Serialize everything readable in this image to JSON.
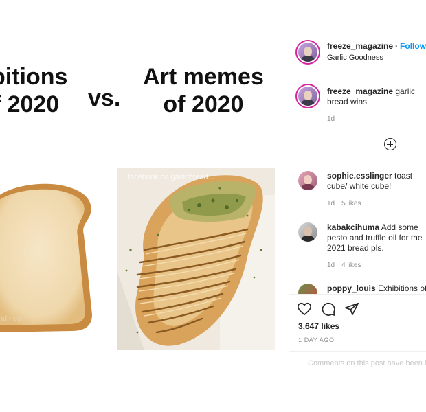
{
  "meme": {
    "title_left_line1": "ibitions",
    "title_left_line2": "f 2020",
    "vs": "vs.",
    "title_right_line1": "Art memes",
    "title_right_line2": "of 2020",
    "watermark_right": "facebook.co   garlicbread...",
    "watermark_left": "ndines"
  },
  "post": {
    "header": {
      "username": "freeze_magazine",
      "dot": "·",
      "follow": "Follow",
      "subtitle": "Garlic Goodness"
    },
    "caption": {
      "username": "freeze_magazine",
      "text": " garlic bread wins",
      "time": "1d"
    },
    "comments": [
      {
        "username": "sophie.esslinger",
        "text": " toast cube/ white cube!",
        "time": "1d",
        "likes": "5 likes"
      },
      {
        "username": "kabakcihuma",
        "text": " Add some pesto and truffle oil for the 2021 bread pls.",
        "time": "1d",
        "likes": "4 likes"
      },
      {
        "username": "poppy_louis",
        "text": " Exhibitions of",
        "time": "",
        "likes": ""
      }
    ],
    "likes": "3,647 likes",
    "age": "1 DAY AGO",
    "comments_disabled": "Comments on this post have been limited."
  }
}
